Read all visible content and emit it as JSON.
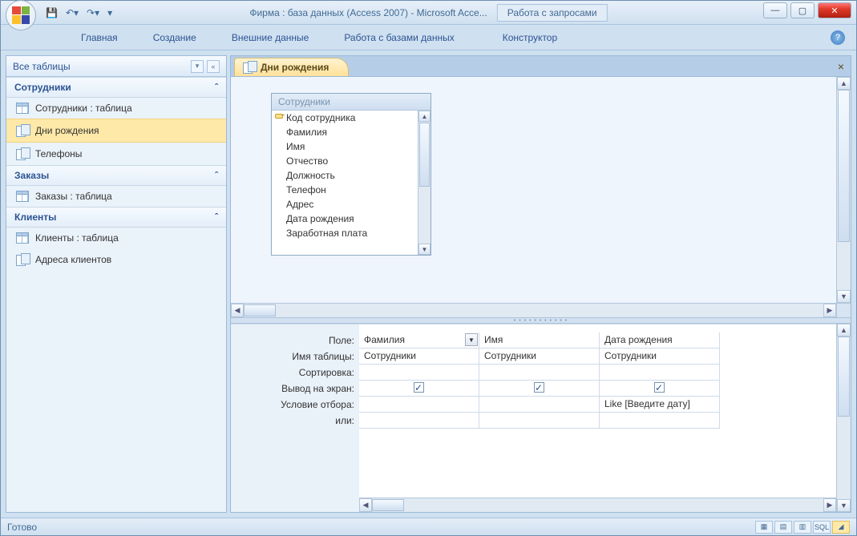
{
  "window": {
    "title": "Фирма : база данных (Access 2007)  -  Microsoft Acce...",
    "context_title": "Работа с запросами"
  },
  "ribbon": {
    "tabs": {
      "home": "Главная",
      "create": "Создание",
      "external": "Внешние данные",
      "db": "Работа с базами данных",
      "design": "Конструктор"
    }
  },
  "nav": {
    "title": "Все таблицы",
    "groups": {
      "g1": {
        "title": "Сотрудники",
        "items": {
          "i0": "Сотрудники : таблица",
          "i1": "Дни рождения",
          "i2": "Телефоны"
        }
      },
      "g2": {
        "title": "Заказы",
        "items": {
          "i0": "Заказы : таблица"
        }
      },
      "g3": {
        "title": "Клиенты",
        "items": {
          "i0": "Клиенты : таблица",
          "i1": "Адреса клиентов"
        }
      }
    }
  },
  "doc": {
    "tab": "Дни рождения"
  },
  "table_box": {
    "title": "Сотрудники",
    "fields": {
      "f0": "Код сотрудника",
      "f1": "Фамилия",
      "f2": "Имя",
      "f3": "Отчество",
      "f4": "Должность",
      "f5": "Телефон",
      "f6": "Адрес",
      "f7": "Дата рождения",
      "f8": "Заработная плата"
    }
  },
  "grid": {
    "labels": {
      "field": "Поле:",
      "table": "Имя таблицы:",
      "sort": "Сортировка:",
      "show": "Вывод на экран:",
      "criteria": "Условие отбора:",
      "or": "или:"
    },
    "cols": {
      "c0": {
        "field": "Фамилия",
        "table": "Сотрудники",
        "criteria": ""
      },
      "c1": {
        "field": "Имя",
        "table": "Сотрудники",
        "criteria": ""
      },
      "c2": {
        "field": "Дата рождения",
        "table": "Сотрудники",
        "criteria": "Like [Введите дату]"
      }
    }
  },
  "status": {
    "text": "Готово",
    "sql": "SQL"
  }
}
